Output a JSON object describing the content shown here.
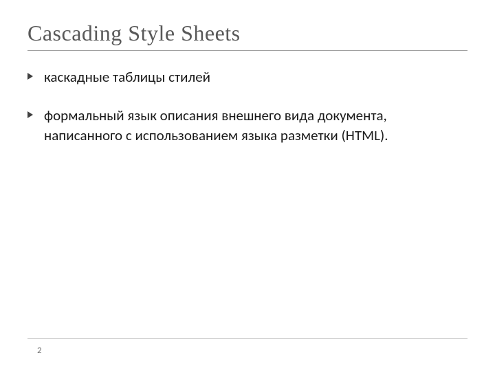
{
  "slide": {
    "title": "Cascading Style Sheets",
    "bullets": [
      {
        "text": "каскадные таблицы стилей"
      },
      {
        "text": "формальный язык описания внешнего вида документа, написанного с использованием языка разметки (HTML)."
      }
    ],
    "page_number": "2"
  }
}
